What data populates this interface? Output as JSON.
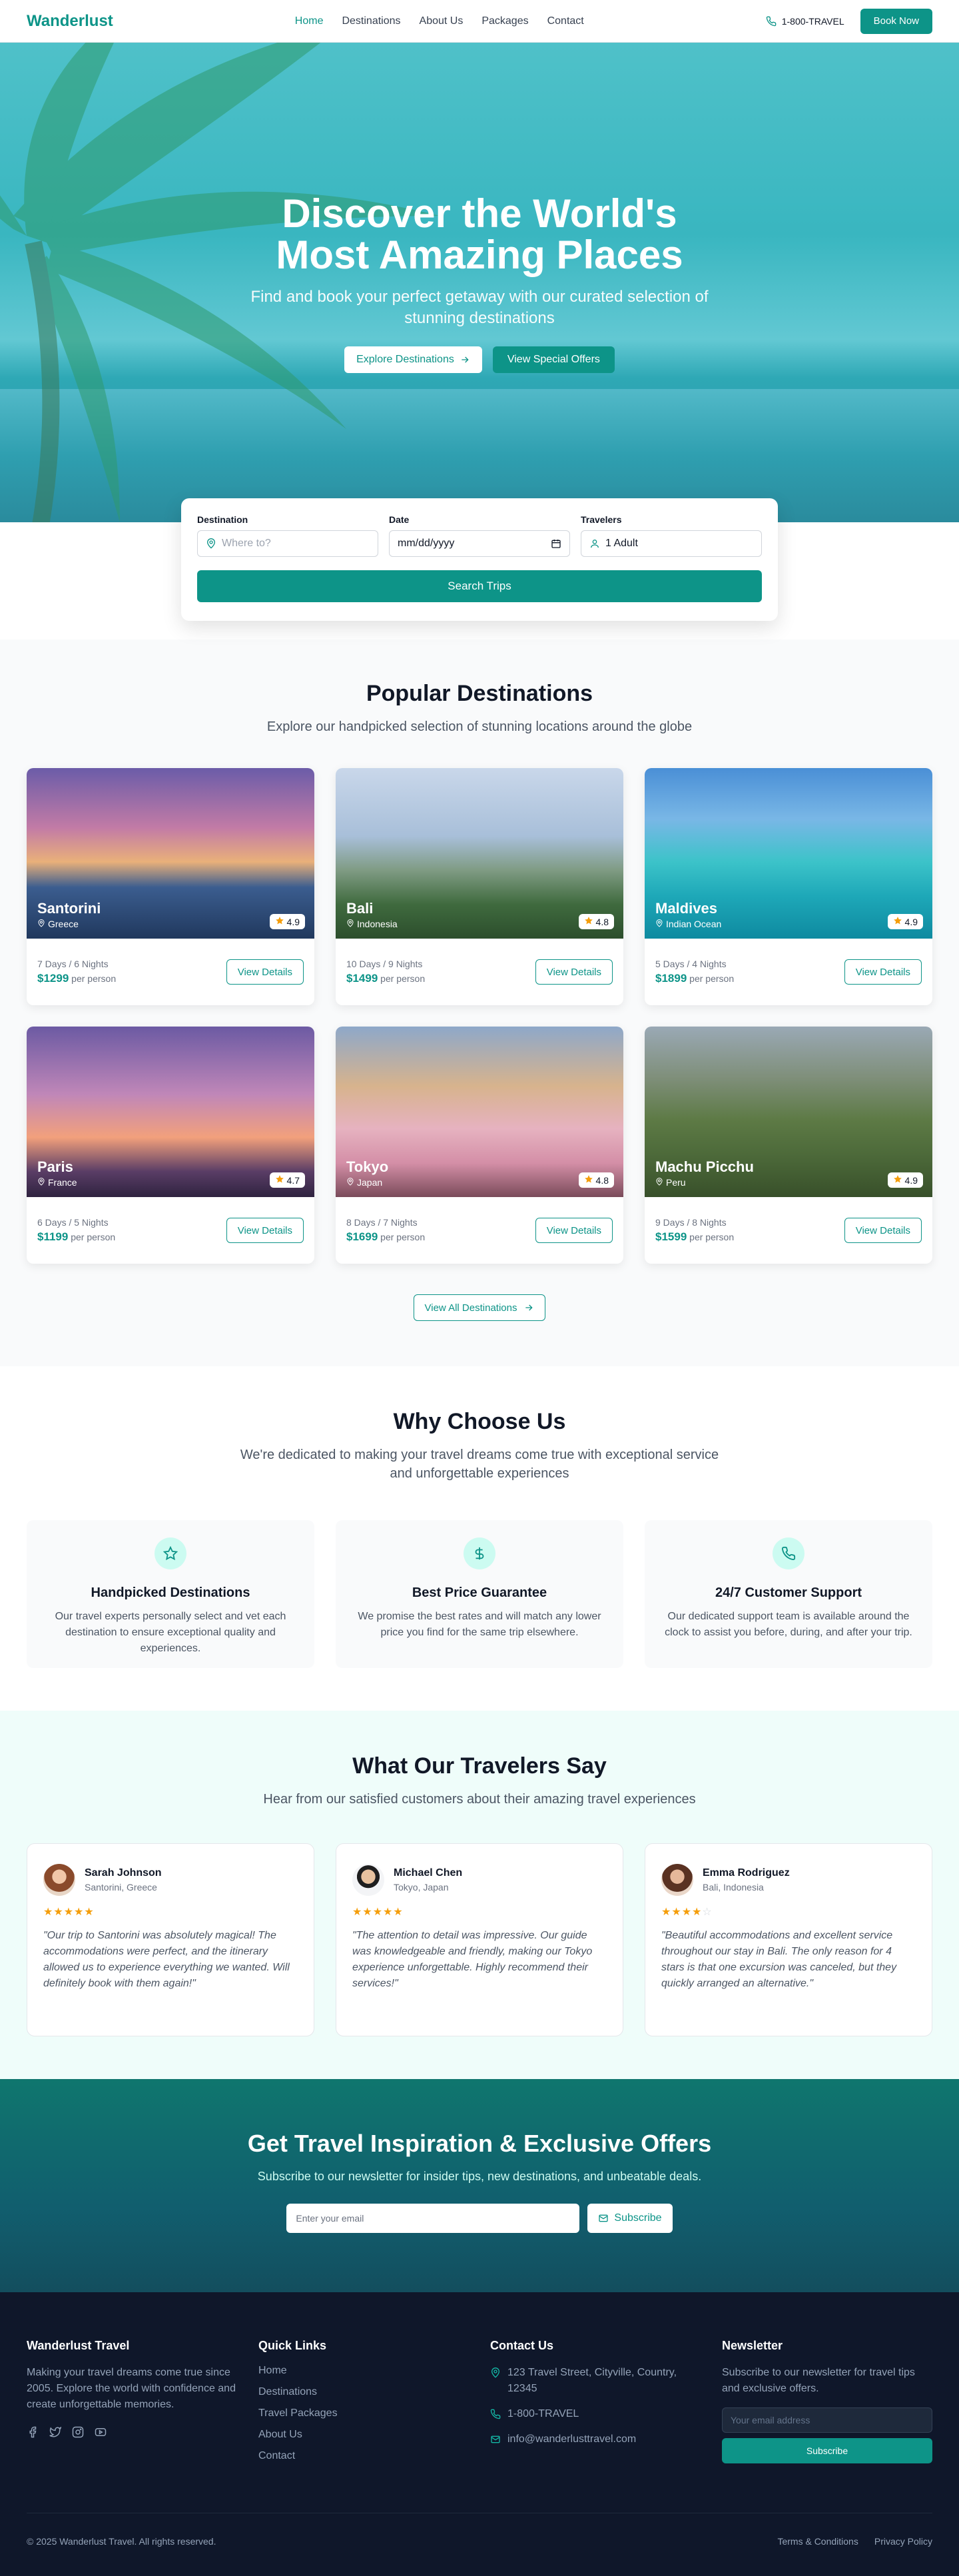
{
  "nav": {
    "brand": "Wanderlust",
    "links": [
      "Home",
      "Destinations",
      "About Us",
      "Packages",
      "Contact"
    ],
    "phone": "1-800-TRAVEL",
    "book": "Book Now"
  },
  "hero": {
    "title": "Discover the World's Most Amazing Places",
    "subtitle": "Find and book your perfect getaway with our curated selection of stunning destinations",
    "explore": "Explore Destinations",
    "offers": "View Special Offers"
  },
  "search": {
    "destination_label": "Destination",
    "destination_placeholder": "Where to?",
    "date_label": "Date",
    "date_value": "mm/dd/yyyy",
    "travelers_label": "Travelers",
    "travelers_value": "1 Adult",
    "button": "Search Trips"
  },
  "popular": {
    "title": "Popular Destinations",
    "subtitle": "Explore our handpicked selection of stunning locations around the globe",
    "view_details": "View Details",
    "view_all": "View All Destinations",
    "per_person": "per person",
    "items": [
      {
        "name": "Santorini",
        "country": "Greece",
        "rating": "4.9",
        "duration": "7 Days / 6 Nights",
        "price": "$1299"
      },
      {
        "name": "Bali",
        "country": "Indonesia",
        "rating": "4.8",
        "duration": "10 Days / 9 Nights",
        "price": "$1499"
      },
      {
        "name": "Maldives",
        "country": "Indian Ocean",
        "rating": "4.9",
        "duration": "5 Days / 4 Nights",
        "price": "$1899"
      },
      {
        "name": "Paris",
        "country": "France",
        "rating": "4.7",
        "duration": "6 Days / 5 Nights",
        "price": "$1199"
      },
      {
        "name": "Tokyo",
        "country": "Japan",
        "rating": "4.8",
        "duration": "8 Days / 7 Nights",
        "price": "$1699"
      },
      {
        "name": "Machu Picchu",
        "country": "Peru",
        "rating": "4.9",
        "duration": "9 Days / 8 Nights",
        "price": "$1599"
      }
    ]
  },
  "why": {
    "title": "Why Choose Us",
    "subtitle": "We're dedicated to making your travel dreams come true with exceptional service and unforgettable experiences",
    "features": [
      {
        "icon": "star-icon",
        "title": "Handpicked Destinations",
        "text": "Our travel experts personally select and vet each destination to ensure exceptional quality and experiences."
      },
      {
        "icon": "dollar-icon",
        "title": "Best Price Guarantee",
        "text": "We promise the best rates and will match any lower price you find for the same trip elsewhere."
      },
      {
        "icon": "phone-icon",
        "title": "24/7 Customer Support",
        "text": "Our dedicated support team is available around the clock to assist you before, during, and after your trip."
      }
    ]
  },
  "testimonials": {
    "title": "What Our Travelers Say",
    "subtitle": "Hear from our satisfied customers about their amazing travel experiences",
    "items": [
      {
        "name": "Sarah Johnson",
        "location": "Santorini, Greece",
        "stars": 5,
        "quote": "\"Our trip to Santorini was absolutely magical! The accommodations were perfect, and the itinerary allowed us to experience everything we wanted. Will definitely book with them again!\""
      },
      {
        "name": "Michael Chen",
        "location": "Tokyo, Japan",
        "stars": 5,
        "quote": "\"The attention to detail was impressive. Our guide was knowledgeable and friendly, making our Tokyo experience unforgettable. Highly recommend their services!\""
      },
      {
        "name": "Emma Rodriguez",
        "location": "Bali, Indonesia",
        "stars": 4,
        "quote": "\"Beautiful accommodations and excellent service throughout our stay in Bali. The only reason for 4 stars is that one excursion was canceled, but they quickly arranged an alternative.\""
      }
    ]
  },
  "newsletter": {
    "title": "Get Travel Inspiration & Exclusive Offers",
    "subtitle": "Subscribe to our newsletter for insider tips, new destinations, and unbeatable deals.",
    "placeholder": "Enter your email",
    "button": "Subscribe"
  },
  "footer": {
    "about_title": "Wanderlust Travel",
    "about_text": "Making your travel dreams come true since 2005. Explore the world with confidence and create unforgettable memories.",
    "links_title": "Quick Links",
    "links": [
      "Home",
      "Destinations",
      "Travel Packages",
      "About Us",
      "Contact"
    ],
    "contact_title": "Contact Us",
    "address": "123 Travel Street, Cityville, Country, 12345",
    "phone": "1-800-TRAVEL",
    "email": "info@wanderlusttravel.com",
    "nl_title": "Newsletter",
    "nl_text": "Subscribe to our newsletter for travel tips and exclusive offers.",
    "nl_placeholder": "Your email address",
    "nl_button": "Subscribe",
    "copyright": "© 2025 Wanderlust Travel. All rights reserved.",
    "terms": "Terms & Conditions",
    "privacy": "Privacy Policy"
  },
  "colors": {
    "accent": "#0d9488",
    "dark": "#0f172a",
    "star": "#f59e0b"
  }
}
